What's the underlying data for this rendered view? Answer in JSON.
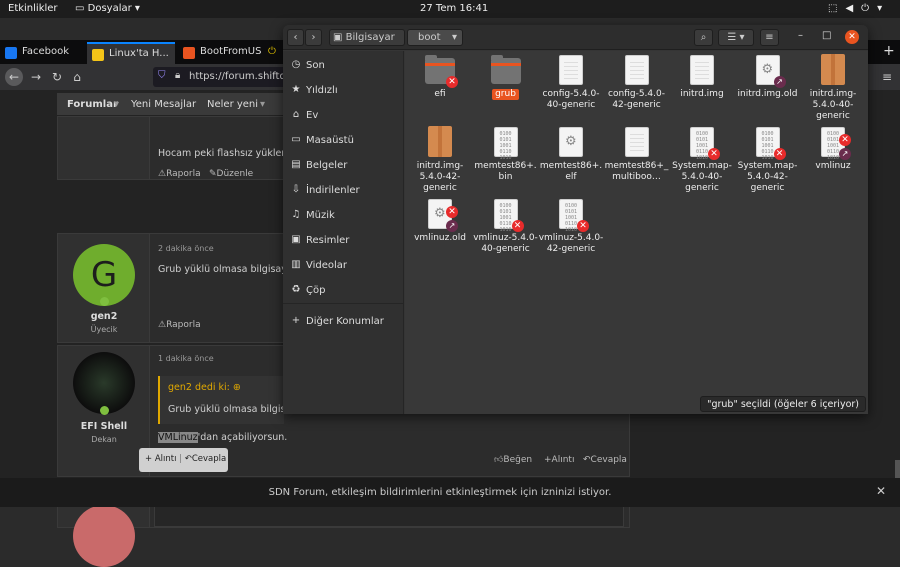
{
  "system": {
    "activities": "Etkinlikler",
    "app_menu": "Dosyalar",
    "clock": "27 Tem  16:41"
  },
  "browser": {
    "tabs": [
      {
        "label": "Facebook",
        "color": "#1877f2"
      },
      {
        "label": "Linux'ta H...",
        "color": "#f5c518"
      },
      {
        "label": "BootFromUS...",
        "color": "#e95420"
      }
    ],
    "url": "https://forum.shiftd",
    "forum_nav": {
      "home": "Forumlar",
      "new": "Yeni Mesajlar",
      "whatsnew": "Neler yeni"
    },
    "posts": [
      {
        "text": "Hocam peki flashsız yükleme",
        "report": "Raporla",
        "edit": "Düzenle"
      },
      {
        "time": "2 dakika önce",
        "text": "Grub yüklü olmasa bilgisayar",
        "user": "gen2",
        "role": "Üyecik",
        "avatar_letter": "G",
        "report": "Raporla"
      },
      {
        "time": "1 dakika önce",
        "quote_author": "gen2 dedi ki: ⊕",
        "quote_text": "Grub yüklü olmasa bilgisayar",
        "reply_sel": "VMLinuz",
        "reply_rest": "'dan açabiliyorsun.",
        "user": "EFI Shell",
        "role": "Dekan",
        "like": "Beğen",
        "quote": "Alıntı",
        "reply": "Cevapla",
        "popup_quote": "Alıntı",
        "popup_reply": "Cevapla"
      }
    ],
    "notification": "SDN Forum, etkileşim bildirimlerini etkinleştirmek için izninizi istiyor."
  },
  "files": {
    "path": [
      "Bilgisayar",
      "boot"
    ],
    "sidebar": [
      {
        "label": "Son",
        "icon": "clock-icon",
        "glyph": "◷"
      },
      {
        "label": "Yıldızlı",
        "icon": "star-icon",
        "glyph": "★"
      },
      {
        "label": "Ev",
        "icon": "home-icon",
        "glyph": "⌂"
      },
      {
        "label": "Masaüstü",
        "icon": "desktop-icon",
        "glyph": "▭"
      },
      {
        "label": "Belgeler",
        "icon": "documents-icon",
        "glyph": "▤"
      },
      {
        "label": "İndirilenler",
        "icon": "downloads-icon",
        "glyph": "⇩"
      },
      {
        "label": "Müzik",
        "icon": "music-icon",
        "glyph": "♫"
      },
      {
        "label": "Resimler",
        "icon": "pictures-icon",
        "glyph": "▣"
      },
      {
        "label": "Videolar",
        "icon": "videos-icon",
        "glyph": "▥"
      },
      {
        "label": "Çöp",
        "icon": "trash-icon",
        "glyph": "♻"
      },
      {
        "label": "Diğer Konumlar",
        "icon": "plus-icon",
        "glyph": "+"
      }
    ],
    "items": [
      {
        "name": "efi",
        "kind": "folder",
        "emblem": "x"
      },
      {
        "name": "grub",
        "kind": "folder",
        "emblem": "",
        "selected": true
      },
      {
        "name": "config-5.4.0-40-generic",
        "kind": "doc",
        "emblem": ""
      },
      {
        "name": "config-5.4.0-42-generic",
        "kind": "doc",
        "emblem": ""
      },
      {
        "name": "initrd.img",
        "kind": "doc",
        "emblem": ""
      },
      {
        "name": "initrd.img.old",
        "kind": "gear",
        "emblem": "link"
      },
      {
        "name": "initrd.img-5.4.0-40-generic",
        "kind": "pkg",
        "emblem": ""
      },
      {
        "name": "initrd.img-5.4.0-42-generic",
        "kind": "pkg",
        "emblem": ""
      },
      {
        "name": "memtest86+.bin",
        "kind": "bin",
        "emblem": ""
      },
      {
        "name": "memtest86+.elf",
        "kind": "gear",
        "emblem": ""
      },
      {
        "name": "memtest86+_multiboo…",
        "kind": "doc",
        "emblem": ""
      },
      {
        "name": "System.map-5.4.0-40-generic",
        "kind": "bin",
        "emblem": "x"
      },
      {
        "name": "System.map-5.4.0-42-generic",
        "kind": "bin",
        "emblem": "x"
      },
      {
        "name": "vmlinuz",
        "kind": "bin",
        "emblem": "xlink"
      },
      {
        "name": "vmlinuz.old",
        "kind": "gear",
        "emblem": "xlink"
      },
      {
        "name": "vmlinuz-5.4.0-40-generic",
        "kind": "bin",
        "emblem": "x"
      },
      {
        "name": "vmlinuz-5.4.0-42-generic",
        "kind": "bin",
        "emblem": "x"
      }
    ],
    "status": "\"grub\" seçildi  (öğeler 6 içeriyor)"
  }
}
